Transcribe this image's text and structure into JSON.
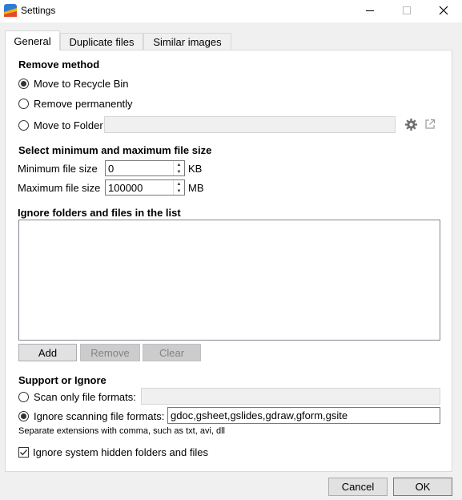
{
  "window": {
    "title": "Settings",
    "controls": {
      "minimize": "minimize",
      "maximize": "maximize",
      "close": "close"
    }
  },
  "tabs": [
    {
      "label": "General",
      "active": true
    },
    {
      "label": "Duplicate files",
      "active": false
    },
    {
      "label": "Similar images",
      "active": false
    }
  ],
  "remove_method": {
    "title": "Remove method",
    "options": [
      {
        "label": "Move to Recycle Bin",
        "selected": true
      },
      {
        "label": "Remove permanently",
        "selected": false
      },
      {
        "label": "Move to Folder",
        "selected": false
      }
    ],
    "folder_path": ""
  },
  "file_size": {
    "title": "Select minimum and maximum file size",
    "min_label": "Minimum file size",
    "min_value": "0",
    "min_unit": "KB",
    "max_label": "Maximum file size",
    "max_value": "100000",
    "max_unit": "MB"
  },
  "ignore_list": {
    "title": "Ignore folders and files in the list",
    "items": [],
    "add_label": "Add",
    "remove_label": "Remove",
    "clear_label": "Clear"
  },
  "support": {
    "title": "Support or Ignore",
    "scan_only_label": "Scan only file formats:",
    "scan_only_value": "",
    "scan_only_selected": false,
    "ignore_label": "Ignore scanning file formats:",
    "ignore_value": "gdoc,gsheet,gslides,gdraw,gform,gsite",
    "ignore_selected": true,
    "hint": "Separate extensions with comma, such as txt, avi, dll"
  },
  "hidden": {
    "label": "Ignore system hidden folders and files",
    "checked": true
  },
  "footer": {
    "cancel_label": "Cancel",
    "ok_label": "OK"
  },
  "colors": {
    "accent": "#0078d7",
    "disabled_field": "#f0f0f0"
  }
}
